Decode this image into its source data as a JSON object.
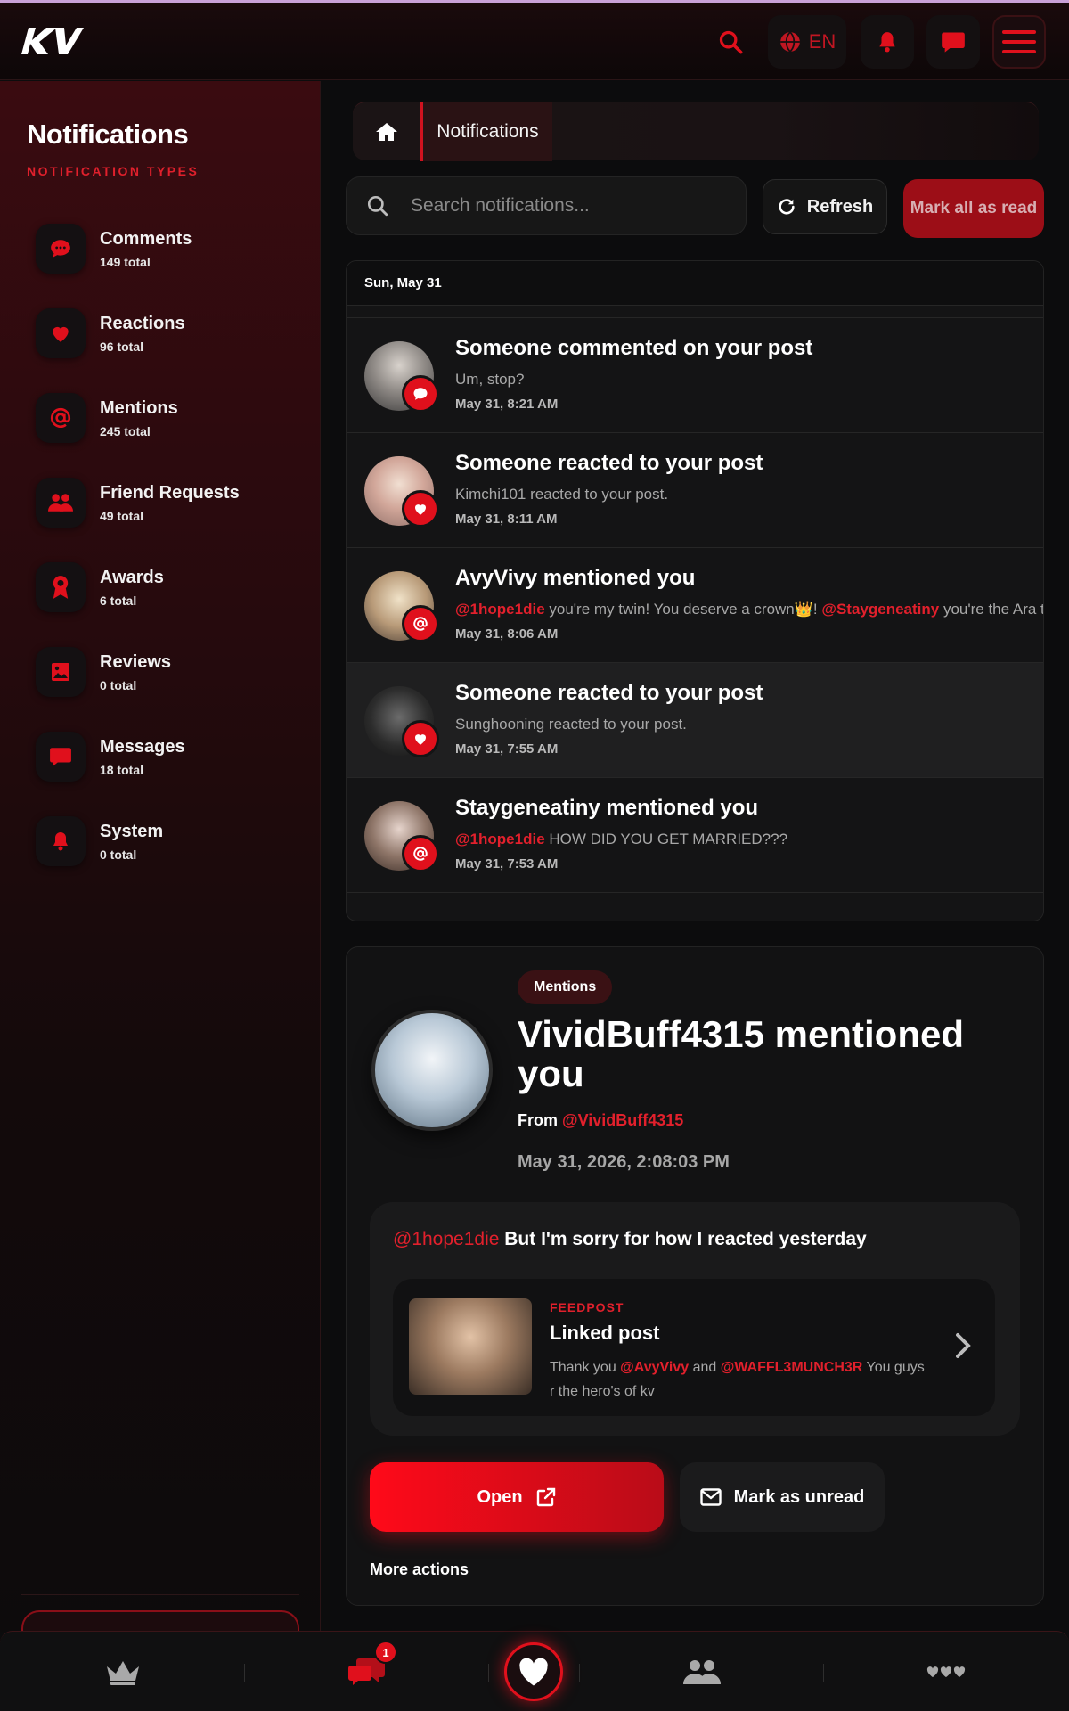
{
  "header": {
    "logo_text": "KV",
    "language": "EN"
  },
  "sidebar": {
    "title": "Notifications",
    "subtitle": "NOTIFICATION TYPES",
    "items": [
      {
        "label": "Comments",
        "count": "149 total",
        "icon": "comment-icon"
      },
      {
        "label": "Reactions",
        "count": "96 total",
        "icon": "heart-icon"
      },
      {
        "label": "Mentions",
        "count": "245 total",
        "icon": "at-icon"
      },
      {
        "label": "Friend Requests",
        "count": "49 total",
        "icon": "friends-icon"
      },
      {
        "label": "Awards",
        "count": "6 total",
        "icon": "award-icon"
      },
      {
        "label": "Reviews",
        "count": "0 total",
        "icon": "image-icon"
      },
      {
        "label": "Messages",
        "count": "18 total",
        "icon": "message-icon"
      },
      {
        "label": "System",
        "count": "0 total",
        "icon": "bell-icon"
      }
    ]
  },
  "breadcrumb": {
    "current": "Notifications"
  },
  "toolbar": {
    "search_placeholder": "Search notifications...",
    "refresh_label": "Refresh",
    "mark_all_label": "Mark all as read"
  },
  "list": {
    "date_header": "Sun, May 31",
    "items": [
      {
        "title": "Someone commented on your post",
        "body": "Um, stop?",
        "time": "May 31, 8:21 AM",
        "type": "comment"
      },
      {
        "title": "Someone reacted to your post",
        "body": "Kimchi101 reacted to your post.",
        "time": "May 31, 8:11 AM",
        "type": "reaction"
      },
      {
        "title": "AvyVivy mentioned you",
        "mention1": "@1hope1die",
        "body_mid": " you're my twin! You deserve a crown👑! ",
        "mention2": "@Staygeneatiny",
        "body_end": " you're the Ara to...",
        "time": "May 31, 8:06 AM",
        "type": "mention"
      },
      {
        "title": "Someone reacted to your post",
        "body": "Sunghooning reacted to your post.",
        "time": "May 31, 7:55 AM",
        "type": "reaction"
      },
      {
        "title": "Staygeneatiny mentioned you",
        "mention1": "@1hope1die",
        "body_mid": " HOW DID YOU GET MARRIED???",
        "time": "May 31, 7:53 AM",
        "type": "mention"
      }
    ]
  },
  "detail": {
    "tag": "Mentions",
    "title": "VividBuff4315 mentioned you",
    "from_label": "From ",
    "from_user": "@VividBuff4315",
    "date": "May 31, 2026, 2:08:03 PM",
    "quote_mention": "@1hope1die",
    "quote_text": " But I'm sorry for how I reacted yesterday",
    "linked": {
      "kind": "FEEDPOST",
      "title": "Linked post",
      "body_a": "Thank you ",
      "mention_a": "@AvyVivy",
      "body_b": " and ",
      "mention_b": "@WAFFL3MUNCH3R",
      "body_c": " You guys r the hero's of kv"
    },
    "open_label": "Open",
    "unread_label": "Mark as unread",
    "more_actions_label": "More actions"
  },
  "bottom_nav": {
    "messages_badge": "1"
  },
  "colors": {
    "accent": "#e0101c",
    "background": "#0c0c0d",
    "sidebar_top": "#3a0b10"
  }
}
